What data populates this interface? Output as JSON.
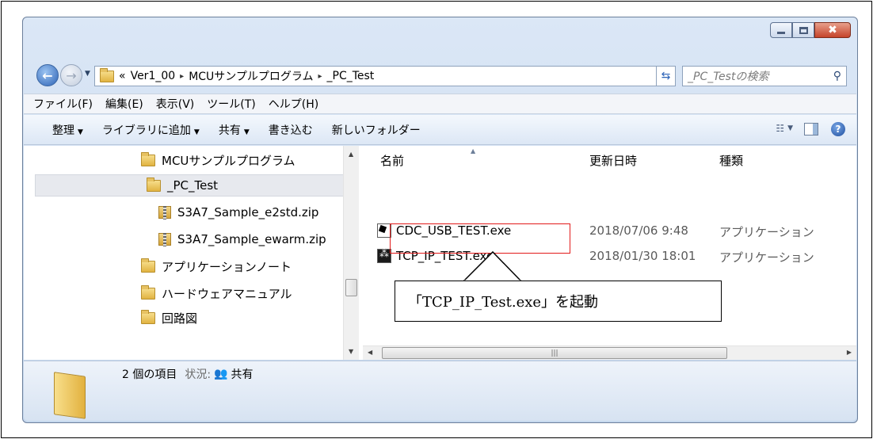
{
  "window": {
    "caption_buttons": {
      "minimize": "minimize",
      "maximize": "maximize",
      "close": "✖"
    }
  },
  "address_bar": {
    "overflow": "«",
    "crumbs": [
      "Ver1_00",
      "MCUサンプルプログラム",
      "_PC_Test"
    ],
    "separator": "▸",
    "search_placeholder": "_PC_Testの検索"
  },
  "menu": [
    "ファイル(F)",
    "編集(E)",
    "表示(V)",
    "ツール(T)",
    "ヘルプ(H)"
  ],
  "commands": [
    {
      "label": "整理",
      "dropdown": true
    },
    {
      "label": "ライブラリに追加",
      "dropdown": true
    },
    {
      "label": "共有",
      "dropdown": true
    },
    {
      "label": "書き込む",
      "dropdown": false
    },
    {
      "label": "新しいフォルダー",
      "dropdown": false
    }
  ],
  "nav_items": [
    {
      "label": "MCUサンプルプログラム",
      "icon": "folder-icon",
      "selected": false
    },
    {
      "label": "_PC_Test",
      "icon": "folder-icon",
      "selected": true
    },
    {
      "label": "S3A7_Sample_e2std.zip",
      "icon": "zip-folder-icon",
      "selected": false
    },
    {
      "label": "S3A7_Sample_ewarm.zip",
      "icon": "zip-folder-icon",
      "selected": false
    },
    {
      "label": "アプリケーションノート",
      "icon": "folder-icon",
      "selected": false
    },
    {
      "label": "ハードウェアマニュアル",
      "icon": "folder-icon",
      "selected": false
    },
    {
      "label": "回路図",
      "icon": "folder-icon",
      "selected": false
    }
  ],
  "columns": {
    "name": "名前",
    "date": "更新日時",
    "type": "種類"
  },
  "files": [
    {
      "name": "CDC_USB_TEST.exe",
      "date": "2018/07/06 9:48",
      "type": "アプリケーション"
    },
    {
      "name": "TCP_IP_TEST.exe",
      "date": "2018/01/30 18:01",
      "type": "アプリケーション"
    }
  ],
  "status": {
    "count": "2 個の項目",
    "state_label": "状況:",
    "state_value": "共有"
  },
  "annotation": {
    "callout": "「TCP_IP_Test.exe」を起動",
    "highlight_color": "#e21b1b"
  },
  "colors": {
    "accent": "#2c62b5",
    "selection": "#e7e9ee"
  }
}
